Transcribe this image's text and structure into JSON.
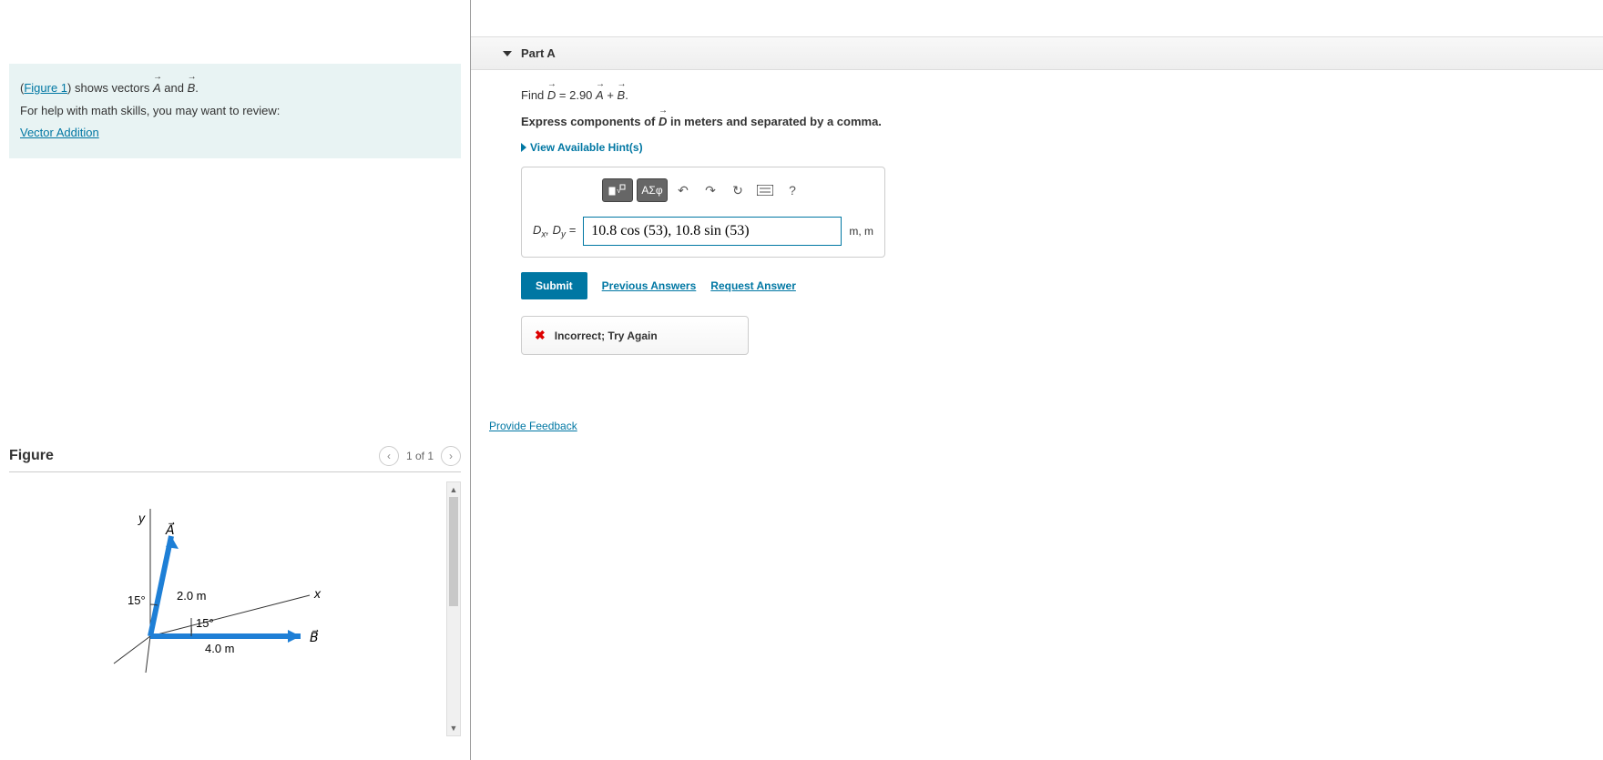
{
  "info": {
    "figure_link": "Figure 1",
    "shows_text_1": ") shows vectors ",
    "vec_a": "A",
    "and_text": " and ",
    "vec_b": "B",
    "period": ".",
    "help_text": "For help with math skills, you may want to review:",
    "vector_addition_link": "Vector Addition"
  },
  "figure": {
    "title": "Figure",
    "page_text": "1 of 1",
    "y_label": "y",
    "x_label": "x",
    "a_label": "A",
    "b_label": "B",
    "a_mag": "2.0 m",
    "b_mag": "4.0 m",
    "a_angle": "15°",
    "b_angle": "15°"
  },
  "part": {
    "title": "Part A",
    "find_text_1": "Find ",
    "d_vec": "D",
    "eq_text": " = 2.90 ",
    "a_vec": "A",
    "plus_text": " + ",
    "b_vec": "B",
    "period": ".",
    "express_1": "Express components of ",
    "express_2": " in meters and separated by a comma.",
    "hints_text": "View Available Hint(s)",
    "answer_prefix": "Dₓ, Dᵧ =",
    "answer_value": "10.8 cos (53), 10.8 sin (53)",
    "answer_unit": "m, m",
    "submit_label": "Submit",
    "prev_answers": "Previous Answers",
    "request_answer": "Request Answer",
    "incorrect_text": "Incorrect; Try Again",
    "tool_sqrt": "√",
    "tool_greek": "ΑΣφ"
  },
  "feedback_link": "Provide Feedback",
  "chart_data": {
    "type": "vector-diagram",
    "vectors": [
      {
        "name": "A",
        "magnitude": 2.0,
        "unit": "m",
        "angle_from_y_axis_deg": 15
      },
      {
        "name": "B",
        "magnitude": 4.0,
        "unit": "m",
        "angle_from_x_axis_deg": -15
      }
    ],
    "axes": [
      "x",
      "y"
    ]
  }
}
